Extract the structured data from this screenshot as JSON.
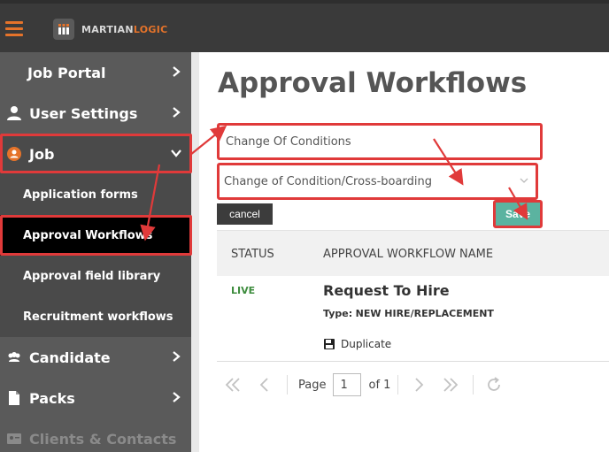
{
  "brand": {
    "part1": "MARTIAN",
    "part2": "LOGIC",
    "accent_color": "#e5732a"
  },
  "sidebar": {
    "items": [
      {
        "label": "Job Portal",
        "icon": "none"
      },
      {
        "label": "User Settings",
        "icon": "user-icon"
      },
      {
        "label": "Job",
        "icon": "job-icon"
      },
      {
        "label": "Candidate",
        "icon": "users-icon"
      },
      {
        "label": "Packs",
        "icon": "file-icon"
      },
      {
        "label": "Clients & Contacts",
        "icon": "contacts-icon"
      }
    ],
    "subitems": [
      {
        "label": "Application forms"
      },
      {
        "label": "Approval Workflows"
      },
      {
        "label": "Approval field library"
      },
      {
        "label": "Recruitment workflows"
      }
    ]
  },
  "page": {
    "title": "Approval Workflows"
  },
  "form": {
    "name_value": "Change Of Conditions",
    "type_value": "Change of Condition/Cross-boarding",
    "cancel_label": "cancel",
    "save_label": "Save"
  },
  "table": {
    "columns": [
      "STATUS",
      "APPROVAL WORKFLOW NAME"
    ],
    "rows": [
      {
        "status": "LIVE",
        "name": "Request To Hire",
        "type_key": "Type:",
        "type_value": "NEW HIRE/REPLACEMENT",
        "action": "Duplicate"
      }
    ]
  },
  "pager": {
    "page_label": "Page",
    "page_value": "1",
    "of_label": "of 1"
  },
  "colors": {
    "highlight": "#e03a3a",
    "save": "#5bb3a0",
    "live": "#3d8c3d"
  }
}
